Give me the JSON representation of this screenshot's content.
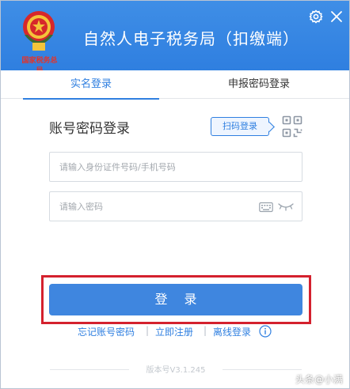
{
  "window": {
    "title": "自然人电子税务局（扣缴端）",
    "logo_caption": "国家税务总局"
  },
  "titlebar": {
    "settings_icon": "gear-icon",
    "close_icon": "close-icon"
  },
  "tabs": [
    {
      "label": "实名登录",
      "active": true
    },
    {
      "label": "申报密码登录",
      "active": false
    }
  ],
  "form": {
    "heading": "账号密码登录",
    "scan_button_label": "扫码登录",
    "qr_icon": "qr-code-icon",
    "id_field": {
      "placeholder": "请输入身份证件号码/手机号码",
      "value": ""
    },
    "password_field": {
      "placeholder": "请输入密码",
      "value": ""
    },
    "keyboard_icon": "keyboard-icon",
    "visibility_icon": "eye-closed-icon",
    "login_button_label": "登 录"
  },
  "links": {
    "forgot": "忘记账号密码",
    "register": "立即注册",
    "offline": "离线登录",
    "separator": "|",
    "info_icon": "info-icon"
  },
  "footer": {
    "version": "版本号V3.1.245",
    "watermark": "头条@小满"
  },
  "colors": {
    "primary": "#2f7fe0",
    "button": "#3f86df",
    "highlight": "#d4212e"
  }
}
